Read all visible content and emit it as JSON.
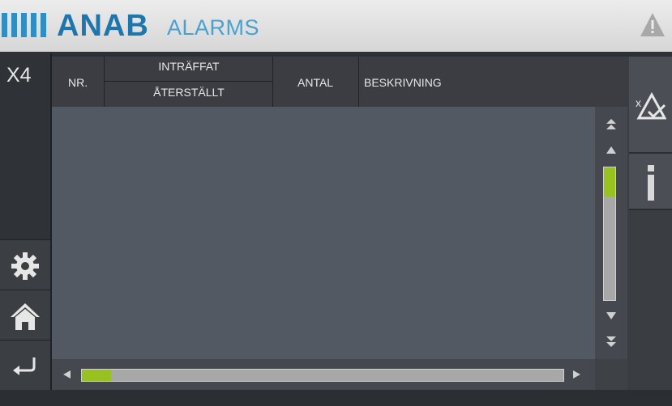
{
  "header": {
    "brand": "ANAB",
    "title": "ALARMS",
    "warning_icon": "warning-triangle-icon"
  },
  "left_panel": {
    "x4_label": "X4",
    "buttons": [
      "gear-icon",
      "home-icon",
      "back-arrow-icon"
    ]
  },
  "table": {
    "headers": {
      "nr": "NR.",
      "occurred": "INTRÄFFAT",
      "reset": "ÅTERSTÄLLT",
      "count": "ANTAL",
      "description": "BESKRIVNING"
    },
    "rows": []
  },
  "scroll": {
    "vertical_position": 0.0,
    "horizontal_position": 0.0
  },
  "right_panel": {
    "acknowledge_icon": "acknowledge-alarms-icon",
    "info_icon": "info-icon"
  },
  "colors": {
    "accent": "#97c21f",
    "brand": "#1f76ad",
    "panel": "#535963"
  }
}
